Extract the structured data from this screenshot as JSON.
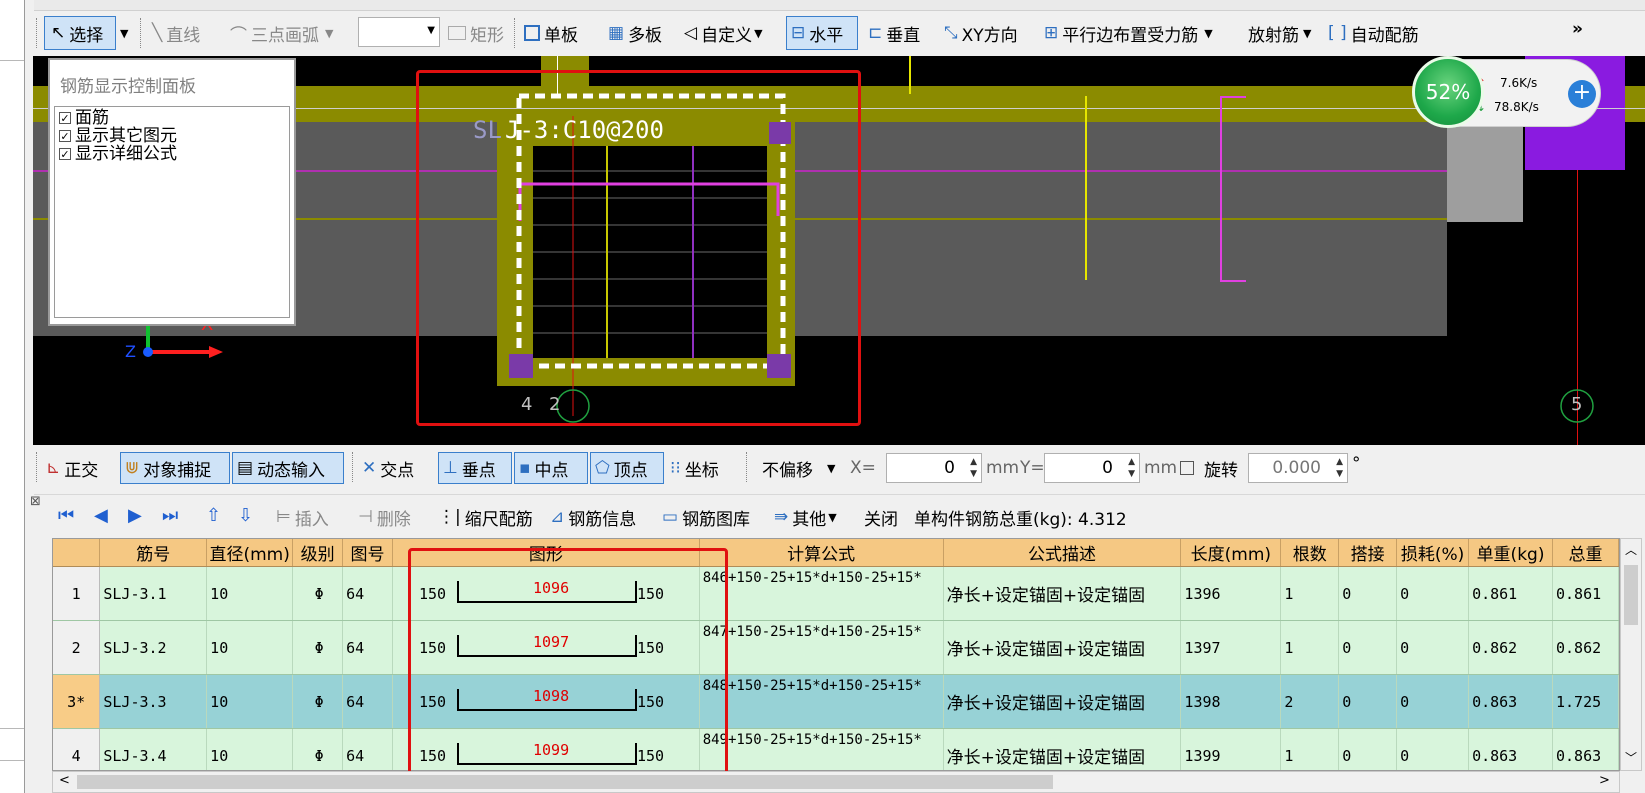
{
  "toolbar": {
    "select": "选择",
    "line": "直线",
    "arc": "三点画弧",
    "rect": "矩形",
    "single_board": "单板",
    "multi_board": "多板",
    "custom": "自定义",
    "horizontal": "水平",
    "vertical": "垂直",
    "xy": "XY方向",
    "parallel_edge": "平行边布置受力筋",
    "radial": "放射筋",
    "auto": "自动配筋",
    "more": "»"
  },
  "control_panel": {
    "title": "钢筋显示控制面板",
    "items": [
      {
        "label": "面筋",
        "checked": true
      },
      {
        "label": "显示其它图元",
        "checked": true
      },
      {
        "label": "显示详细公式",
        "checked": true
      }
    ]
  },
  "canvas": {
    "rebar_label": "J-3:C10@200",
    "rebar_prefix": "SL",
    "axis_left": "4",
    "axis_mid": "2",
    "axis_right": "5",
    "z_label": "Z",
    "x_label": "X"
  },
  "speed": {
    "percent": "52%",
    "up": "7.6K/s",
    "down": "78.8K/s"
  },
  "snapbar": {
    "ortho": "正交",
    "snap": "对象捕捉",
    "dynamic": "动态输入",
    "intersect": "交点",
    "perp": "垂点",
    "mid": "中点",
    "vertex": "顶点",
    "coord": "坐标",
    "offset": "不偏移",
    "x_label": "X=",
    "x_value": "0",
    "mm1": "mm",
    "y_label": "Y=",
    "y_value": "0",
    "mm2": "mm",
    "rotate": "旋转",
    "rotate_value": "0.000",
    "degree": "°"
  },
  "gridbar": {
    "insert": "插入",
    "delete": "删除",
    "scale": "缩尺配筋",
    "info": "钢筋信息",
    "library": "钢筋图库",
    "other": "其他",
    "close": "关闭",
    "total": "单构件钢筋总重(kg): 4.312"
  },
  "table": {
    "headers": [
      "",
      "筋号",
      "直径(mm)",
      "级别",
      "图号",
      "图形",
      "计算公式",
      "公式描述",
      "长度(mm)",
      "根数",
      "搭接",
      "损耗(%)",
      "单重(kg)",
      "总重"
    ],
    "rows": [
      {
        "no": "1",
        "name": "SLJ-3.1",
        "dia": "10",
        "grade": "Φ",
        "fig": "64",
        "left": "150",
        "mid": "1096",
        "right": "150",
        "formula": "846+150-25+15*d+150-25+15*",
        "desc": "净长+设定锚固+设定锚固",
        "length": "1396",
        "count": "1",
        "lap": "0",
        "loss": "0",
        "unit": "0.861",
        "total": "0.861"
      },
      {
        "no": "2",
        "name": "SLJ-3.2",
        "dia": "10",
        "grade": "Φ",
        "fig": "64",
        "left": "150",
        "mid": "1097",
        "right": "150",
        "formula": "847+150-25+15*d+150-25+15*",
        "desc": "净长+设定锚固+设定锚固",
        "length": "1397",
        "count": "1",
        "lap": "0",
        "loss": "0",
        "unit": "0.862",
        "total": "0.862"
      },
      {
        "no": "3*",
        "name": "SLJ-3.3",
        "dia": "10",
        "grade": "Φ",
        "fig": "64",
        "left": "150",
        "mid": "1098",
        "right": "150",
        "formula": "848+150-25+15*d+150-25+15*",
        "desc": "净长+设定锚固+设定锚固",
        "length": "1398",
        "count": "2",
        "lap": "0",
        "loss": "0",
        "unit": "0.863",
        "total": "1.725"
      },
      {
        "no": "4",
        "name": "SLJ-3.4",
        "dia": "10",
        "grade": "Φ",
        "fig": "64",
        "left": "150",
        "mid": "1099",
        "right": "150",
        "formula": "849+150-25+15*d+150-25+15*",
        "desc": "净长+设定锚固+设定锚固",
        "length": "1399",
        "count": "1",
        "lap": "0",
        "loss": "0",
        "unit": "0.863",
        "total": "0.863"
      }
    ]
  },
  "colors": {
    "accent": "#3a7fcc",
    "header": "#f5c883",
    "row": "#d8f5dc",
    "row_selected": "#97d2d6",
    "highlight": "#e01010"
  }
}
